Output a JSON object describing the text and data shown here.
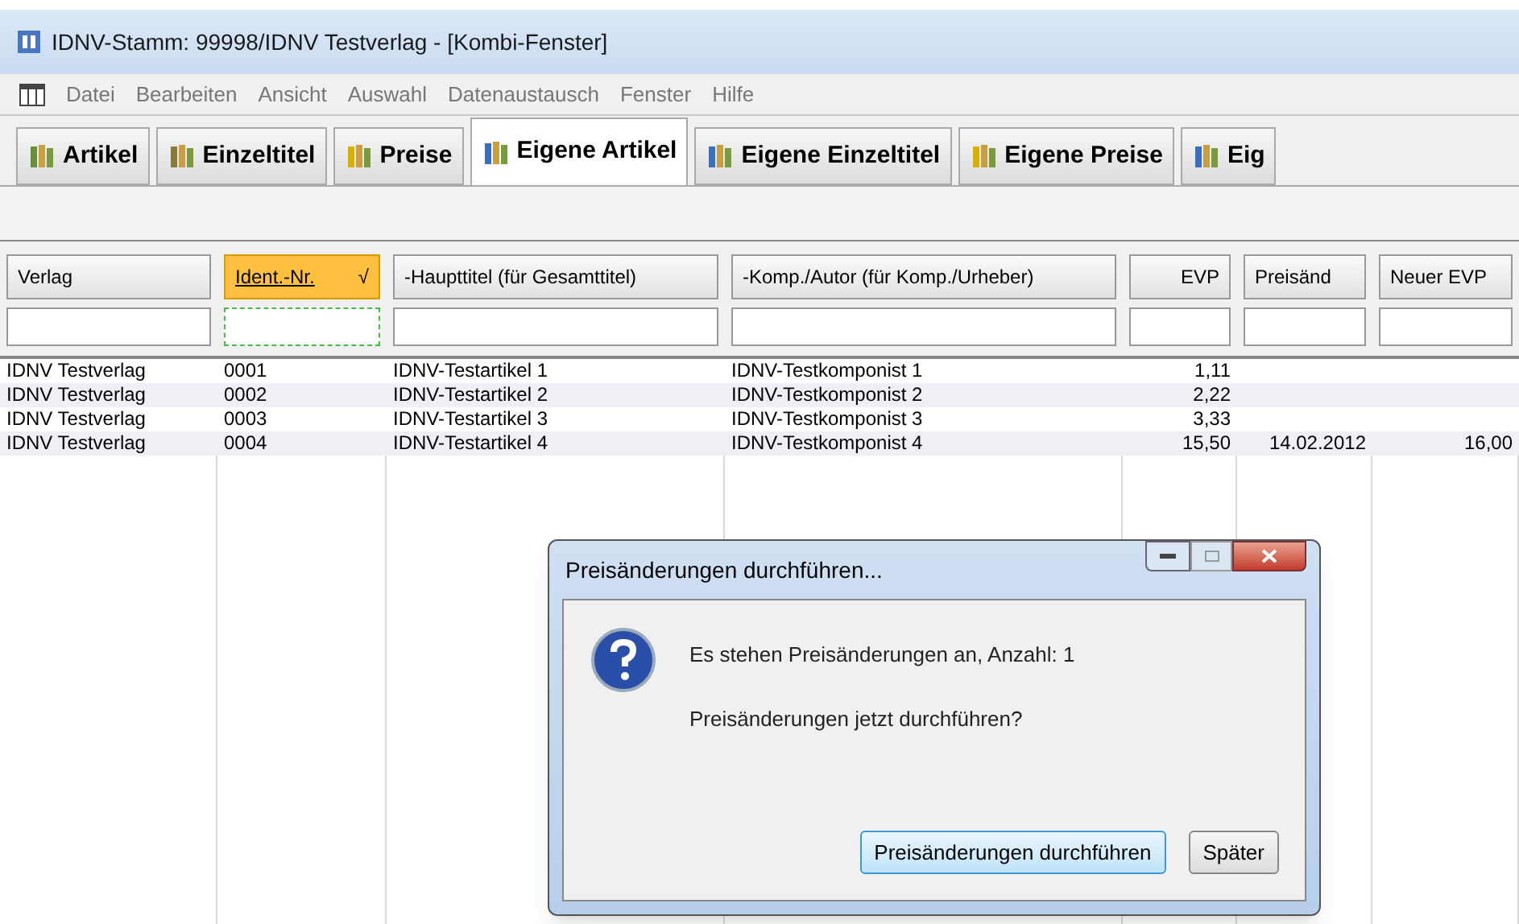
{
  "window": {
    "title": "IDNV-Stamm: 99998/IDNV Testverlag - [Kombi-Fenster]"
  },
  "menu": [
    "Datei",
    "Bearbeiten",
    "Ansicht",
    "Auswahl",
    "Datenaustausch",
    "Fenster",
    "Hilfe"
  ],
  "tabs": [
    {
      "label": "Artikel",
      "selected": false
    },
    {
      "label": "Einzeltitel",
      "selected": false
    },
    {
      "label": "Preise",
      "selected": false
    },
    {
      "label": "Eigene Artikel",
      "selected": true
    },
    {
      "label": "Eigene Einzeltitel",
      "selected": false
    },
    {
      "label": "Eigene Preise",
      "selected": false
    },
    {
      "label": "Eig",
      "selected": false
    }
  ],
  "table": {
    "columns": [
      {
        "label": "Verlag",
        "selected": false
      },
      {
        "label": "Ident.-Nr.",
        "selected": true,
        "sort_mark": "√"
      },
      {
        "label": "-Haupttitel (für Gesamttitel)",
        "selected": false
      },
      {
        "label": "-Komp./Autor (für Komp./Urheber)",
        "selected": false
      },
      {
        "label": "EVP",
        "selected": false
      },
      {
        "label": "Preisänd",
        "selected": false
      },
      {
        "label": "Neuer EVP",
        "selected": false
      }
    ],
    "rows": [
      [
        "IDNV Testverlag",
        "0001",
        "IDNV-Testartikel 1",
        "IDNV-Testkomponist 1",
        "1,11",
        "",
        ""
      ],
      [
        "IDNV Testverlag",
        "0002",
        "IDNV-Testartikel 2",
        "IDNV-Testkomponist 2",
        "2,22",
        "",
        ""
      ],
      [
        "IDNV Testverlag",
        "0003",
        "IDNV-Testartikel 3",
        "IDNV-Testkomponist 3",
        "3,33",
        "",
        ""
      ],
      [
        "IDNV Testverlag",
        "0004",
        "IDNV-Testartikel 4",
        "IDNV-Testkomponist 4",
        "15,50",
        "14.02.2012",
        "16,00"
      ]
    ]
  },
  "dialog": {
    "title": "Preisänderungen durchführen...",
    "message": "Es stehen Preisänderungen an, Anzahl: 1",
    "question": "Preisänderungen jetzt durchführen?",
    "buttons": [
      {
        "label": "Preisänderungen durchführen",
        "selected": true
      },
      {
        "label": "Später",
        "selected": false
      }
    ]
  }
}
